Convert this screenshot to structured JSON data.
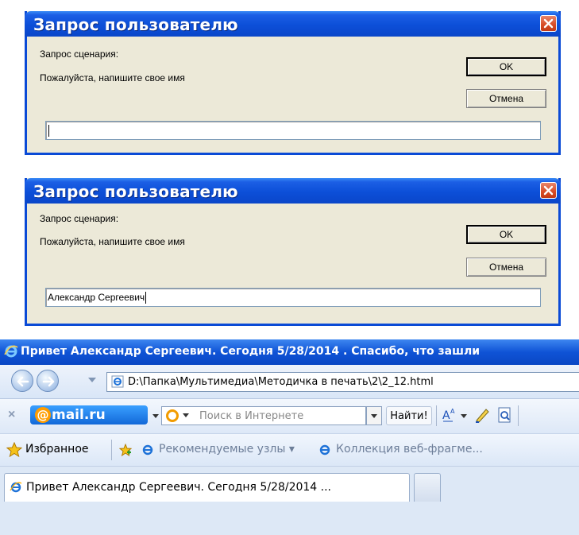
{
  "dialogs": [
    {
      "title": "Запрос пользователю",
      "prompt_heading": "Запрос сценария:",
      "prompt_text": "Пожалуйста, напишите свое имя",
      "ok_label": "OK",
      "cancel_label": "Отмена",
      "input_value": ""
    },
    {
      "title": "Запрос пользователю",
      "prompt_heading": "Запрос сценария:",
      "prompt_text": "Пожалуйста, напишите свое имя",
      "ok_label": "OK",
      "cancel_label": "Отмена",
      "input_value": "Александр Сергеевич"
    }
  ],
  "browser": {
    "window_title": "Привет Александр Сергеевич. Сегодня 5/28/2014 . Спасибо, что зашли",
    "address": "D:\\Папка\\Мультимедиа\\Методичка в печать\\2\\2_12.html",
    "toolbar": {
      "close": "×",
      "mailru_brand": "mail.ru",
      "search_placeholder": "Поиск в Интернете",
      "find_label": "Найти!"
    },
    "favorites": {
      "label": "Избранное",
      "links": [
        "Рекомендуемые узлы ▾",
        "Коллекция веб-фрагме..."
      ]
    },
    "tab_title": "Привет Александр Сергеевич. Сегодня 5/28/2014 ..."
  },
  "colors": {
    "xp_title_blue": "#0c4fd8",
    "close_red": "#d84a24",
    "dialog_face": "#ece9d8",
    "mailru_blue": "#1268d8",
    "mailru_orange": "#ff9d00"
  }
}
